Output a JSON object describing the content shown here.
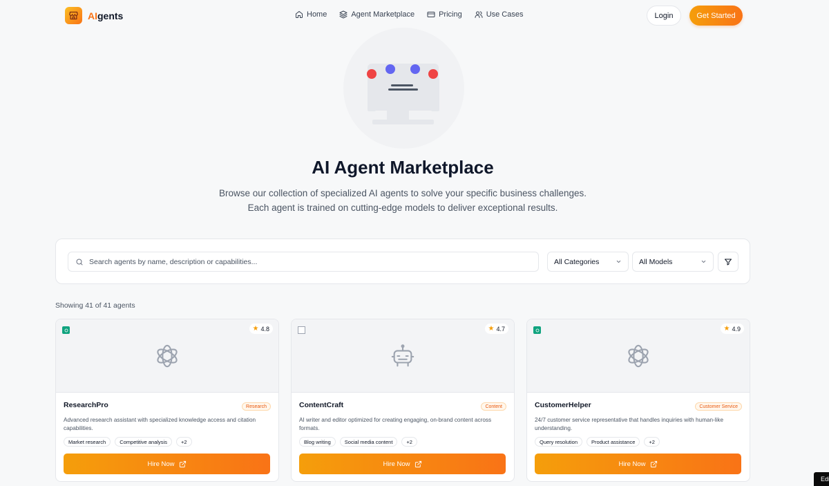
{
  "brand": {
    "prefix": "AI",
    "suffix": "gents"
  },
  "nav": {
    "links": [
      {
        "label": "Home",
        "icon": "home-icon"
      },
      {
        "label": "Agent Marketplace",
        "icon": "layers-icon"
      },
      {
        "label": "Pricing",
        "icon": "credit-card-icon"
      },
      {
        "label": "Use Cases",
        "icon": "users-icon"
      }
    ],
    "login_label": "Login",
    "get_started_label": "Get Started"
  },
  "hero": {
    "title": "AI Agent Marketplace",
    "subtitle": "Browse our collection of specialized AI agents to solve your specific business challenges. Each agent is trained on cutting-edge models to deliver exceptional results."
  },
  "search": {
    "placeholder": "Search agents by name, description or capabilities...",
    "value": "",
    "category_selected": "All Categories",
    "model_selected": "All Models"
  },
  "results": {
    "showing_text": "Showing 41 of 41 agents"
  },
  "cards": [
    {
      "name": "ResearchPro",
      "rating": "4.8",
      "category": "Research",
      "description": "Advanced research assistant with specialized knowledge access and citation capabilities.",
      "tags": [
        "Market research",
        "Competitive analysis",
        "+2"
      ],
      "hire_label": "Hire Now",
      "icon": "openai-logo-icon"
    },
    {
      "name": "ContentCraft",
      "rating": "4.7",
      "category": "Content",
      "description": "AI writer and editor optimized for creating engaging, on-brand content across formats.",
      "tags": [
        "Blog writing",
        "Social media content",
        "+2"
      ],
      "hire_label": "Hire Now",
      "icon": "bot-icon"
    },
    {
      "name": "CustomerHelper",
      "rating": "4.9",
      "category": "Customer Service",
      "description": "24/7 customer service representative that handles inquiries with human-like understanding.",
      "tags": [
        "Query resolution",
        "Product assistance",
        "+2"
      ],
      "hire_label": "Hire Now",
      "icon": "openai-logo-icon"
    }
  ],
  "corner_tab": {
    "label": "Edi"
  },
  "colors": {
    "accent": "#f97316",
    "accent_light": "#f59e0b",
    "rating_star": "#f59e0b"
  }
}
